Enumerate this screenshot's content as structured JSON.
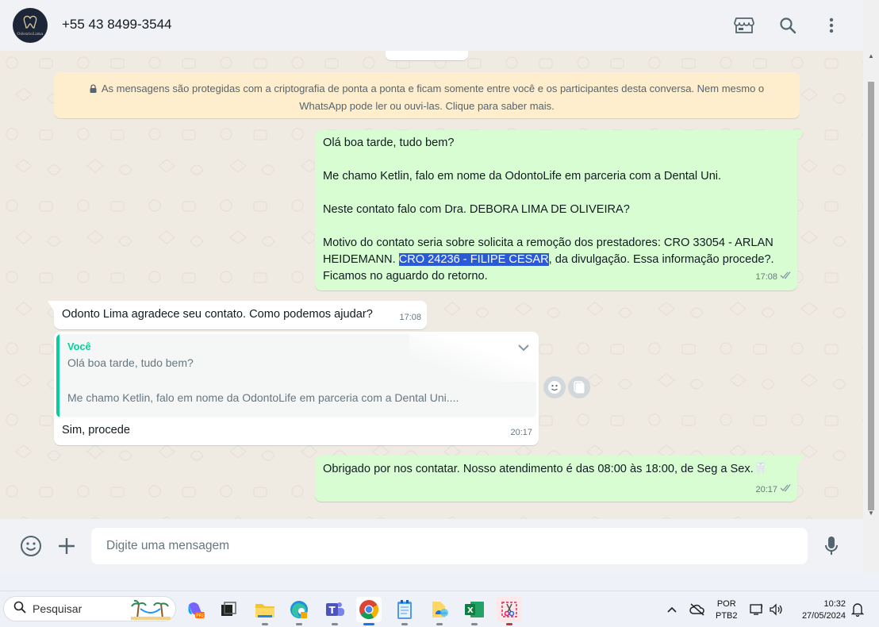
{
  "header": {
    "avatar_text": "OdontoLima",
    "contact": "+55 43 8499-3544",
    "icons": [
      "store-icon",
      "search-icon",
      "menu-icon"
    ]
  },
  "chat": {
    "encryption_notice": "As mensagens são protegidas com a criptografia de ponta a ponta e ficam somente entre você e os participantes desta conversa. Nem mesmo o WhatsApp pode ler ou ouvi-las. Clique para saber mais.",
    "messages": [
      {
        "direction": "out",
        "line1": "Olá boa tarde, tudo bem?",
        "line2": "Me chamo Ketlin, falo em nome da OdontoLife em parceria com a Dental Uni.",
        "line3": "Neste contato falo com Dra. DEBORA LIMA DE OLIVEIRA?",
        "line4a": "Motivo do contato seria sobre solicita a remoção dos prestadores: CRO 33054 - ARLAN HEIDEMANN. ",
        "line4_selected": "CRO 24236 - FILIPE CESAR",
        "line4b": ", da divulgação. Essa informação procede?. Ficamos no aguardo do retorno.",
        "time": "17:08",
        "status": "read"
      },
      {
        "direction": "in",
        "text": "Odonto Lima agradece seu contato. Como podemos ajudar?",
        "time": "17:08"
      },
      {
        "direction": "in",
        "quote_author": "Você",
        "quote_line1": "Olá boa tarde, tudo bem?",
        "quote_line2": "Me chamo Ketlin, falo em nome da OdontoLife em parceria com a Dental Uni....",
        "text": "Sim, procede",
        "time": "20:17"
      },
      {
        "direction": "out",
        "text": "Obrigado por nos contatar. Nosso atendimento é das 08:00 às 18:00, de Seg a Sex.",
        "emoji": "🦷",
        "time": "20:17",
        "status": "read"
      }
    ]
  },
  "composer": {
    "placeholder": "Digite uma mensagem"
  },
  "taskbar": {
    "search_label": "Pesquisar",
    "apps": [
      "copilot",
      "task-view",
      "file-explorer",
      "edge",
      "teams",
      "chrome",
      "notepad",
      "photos",
      "excel",
      "snipping-tool"
    ],
    "active_app": "chrome",
    "lang_line1": "POR",
    "lang_line2": "PTB2",
    "time": "10:32",
    "date": "27/05/2024"
  }
}
